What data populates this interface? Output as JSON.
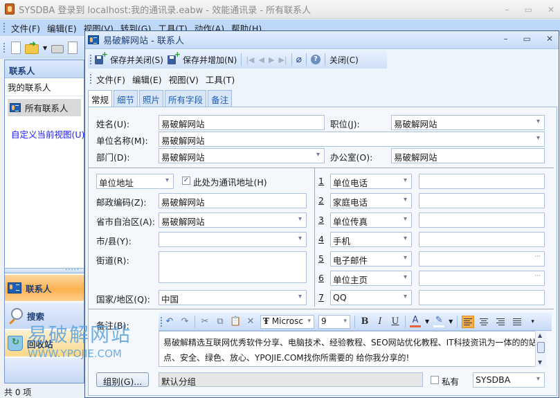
{
  "outer_window": {
    "title": "SYSDBA 登录到 localhost:我的通讯录.eabw - 效能通讯录 - 所有联系人",
    "controls": {
      "minimize": "–",
      "maximize": "▭",
      "close": "✕"
    },
    "menu": [
      "文件(F)",
      "编辑(E)",
      "视图(V)",
      "转到(G)",
      "工具(T)",
      "动作(A)",
      "帮助(H)"
    ],
    "toolbar_icons": [
      "new-document-icon",
      "open-folder-icon",
      "print-icon",
      "print-preview-icon"
    ]
  },
  "nav": {
    "header": "联系人",
    "section": "我的联系人",
    "selected_folder": "所有联系人",
    "customize_link": "自定义当前视图(U)...",
    "buttons": [
      "联系人",
      "搜索",
      "回收站"
    ]
  },
  "status": {
    "count_text": "共 0 项"
  },
  "watermark": {
    "line1": "易破解网站",
    "line2": "WWW.YPOJIE.COM"
  },
  "contact_window": {
    "title": "易破解网站 - 联系人",
    "controls": {
      "minimize": "–",
      "maximize": "▭",
      "close": "✕"
    },
    "toolbar": {
      "save_close": "保存并关闭(S)",
      "save_new": "保存并增加(N)",
      "first": "|◀",
      "prev": "◀",
      "next": "▶",
      "last": "▶|",
      "attach": "📎",
      "help": "?",
      "close": "关闭(C)"
    },
    "menu": [
      "文件(F)",
      "编辑(E)",
      "视图(V)",
      "工具(T)"
    ],
    "tabs": [
      "常规",
      "细节",
      "照片",
      "所有字段",
      "备注"
    ],
    "active_tab": "常规",
    "general": {
      "name_label": "姓名(U):",
      "name_value": "易破解网站",
      "job_label": "职位(J):",
      "job_value": "易破解网站",
      "company_label": "单位名称(M):",
      "company_value": "易破解网站",
      "dept_label": "部门(D):",
      "dept_value": "易破解网站",
      "office_label": "办公室(O):",
      "office_value": "易破解网站",
      "address_type": "单位地址",
      "mailing_checkbox_label": "此处为通讯地址(H)",
      "mailing_checked": true,
      "zip_label": "邮政编码(Z):",
      "zip_value": "易破解网站",
      "province_label": "省市自治区(A):",
      "province_value": "易破解网站",
      "city_label": "市/县(Y):",
      "city_value": "",
      "street_label": "街道(R):",
      "street_value": "",
      "country_label": "国家/地区(Q):",
      "country_value": "中国",
      "phones": [
        {
          "num": "1",
          "type": "单位电话",
          "value": ""
        },
        {
          "num": "2",
          "type": "家庭电话",
          "value": ""
        },
        {
          "num": "3",
          "type": "单位传真",
          "value": ""
        },
        {
          "num": "4",
          "type": "手机",
          "value": ""
        },
        {
          "num": "5",
          "type": "电子邮件",
          "value": ""
        },
        {
          "num": "6",
          "type": "单位主页",
          "value": ""
        },
        {
          "num": "7",
          "type": "QQ",
          "value": ""
        }
      ],
      "notes_label": "备注(B):",
      "notes_text": "易破解精选互联网优秀软件分享、电脑技术、经验教程、SEO网站优化教程、IT科技资讯为一体的的站点、安全、绿色、放心、YPOJIE.COM找你所需要的 给你我分享的!",
      "rich_toolbar": {
        "font_name": "Microsc",
        "font_size": "9",
        "bold": "B",
        "italic": "I",
        "underline": "U",
        "font_color": "#e8603c",
        "highlight_color": "#ffffff"
      },
      "group_button": "组别(G)...",
      "group_value": "默认分组",
      "private_label": "私有",
      "private_checked": false,
      "owner_value": "SYSDBA"
    }
  }
}
